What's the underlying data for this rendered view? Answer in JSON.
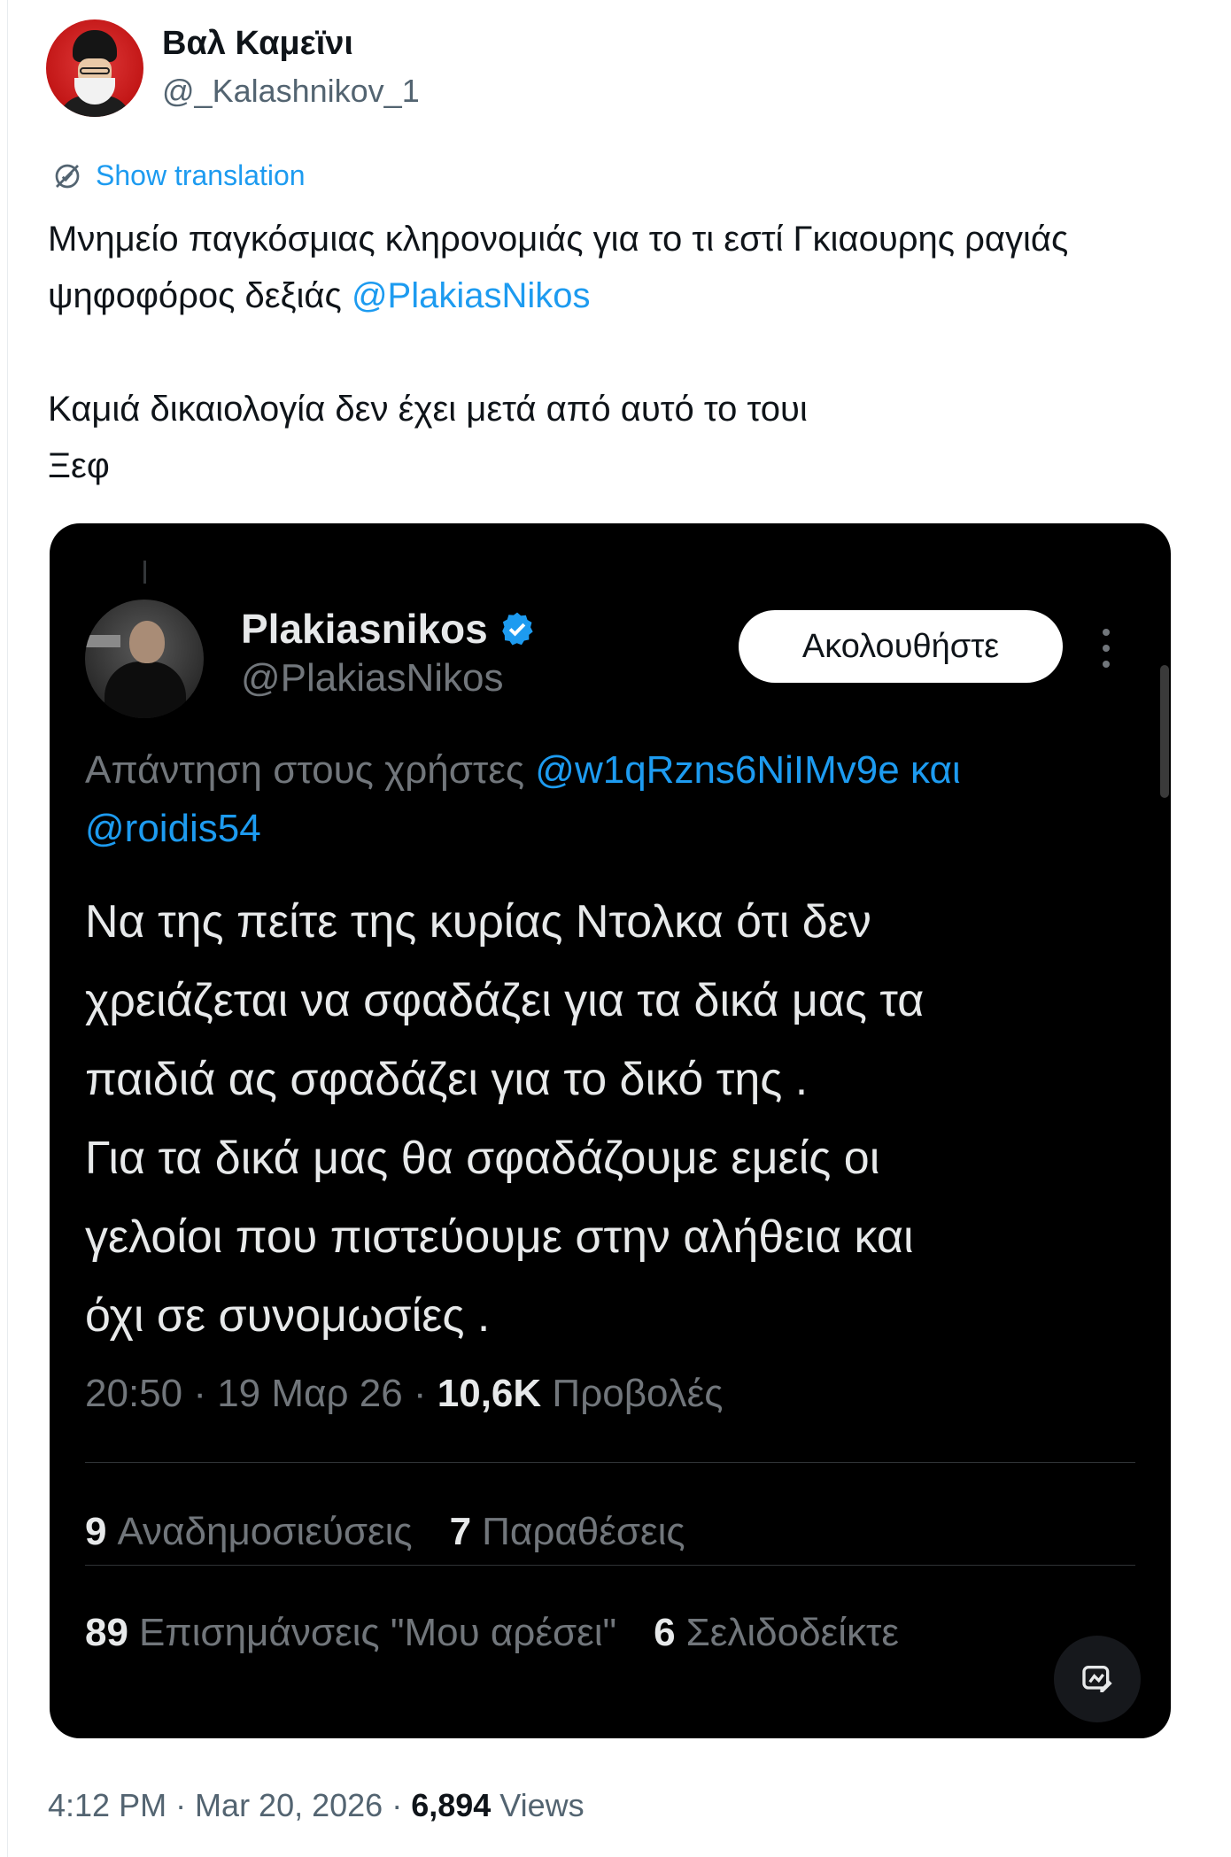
{
  "author": {
    "display_name": "Βαλ Καμεϊνι",
    "handle": "@_Kalashnikov_1"
  },
  "translate": {
    "label": "Show translation",
    "icon": "translate-icon"
  },
  "tweet": {
    "line1_text": "Μνημείο παγκόσμιας κληρονομιάς για το τι εστί Γκιαουρης ραγιάς",
    "line2_text": "ψηφοφόρος δεξιάς ",
    "line2_mention": "@PlakiasNikos",
    "line3_text": "Καμιά δικαιολογία δεν έχει μετά από αυτό το τουι",
    "line4_text": "Ξεφ"
  },
  "quoted": {
    "display_name": "Plakiasnikos",
    "handle": "@PlakiasNikos",
    "verified_color": "#1d9bf0",
    "follow_label": "Ακολουθήστε",
    "reply_prefix": "Απάντηση στους χρήστες ",
    "reply_mention_1": "@w1qRzns6NiIMv9e και",
    "reply_mention_2": "@roidis54",
    "text_lines": [
      "Να της πείτε της κυρίας Ντολκα ότι δεν",
      "χρειάζεται να σφαδάζει για τα δικά μας τα",
      "παιδιά ας σφαδάζει για το  δικό της .",
      "Για τα δικά μας θα σφαδάζουμε εμείς οι",
      "γελοίοι που πιστεύουμε στην αλήθεια και",
      "όχι σε συνομωσίες ."
    ],
    "meta_time": "20:50 · 19 Μαρ 26 · ",
    "meta_views_count": "10,6K",
    "meta_views_label": " Προβολές",
    "reposts_count": "9",
    "reposts_label": "Αναδημοσιεύσεις",
    "quotes_count": "7",
    "quotes_label": "Παραθέσεις",
    "likes_count": "89",
    "likes_label": "Επισημάνσεις \"Μου αρέσει\"",
    "bookmarks_count": "6",
    "bookmarks_label": "Σελιδοδείκτε"
  },
  "footer": {
    "time": "4:12 PM · Mar 20, 2026 · ",
    "views_count": "6,894",
    "views_label": " Views"
  },
  "colors": {
    "link": "#1d9bf0",
    "secondary_text": "#536471",
    "dark_card": "#000000"
  }
}
